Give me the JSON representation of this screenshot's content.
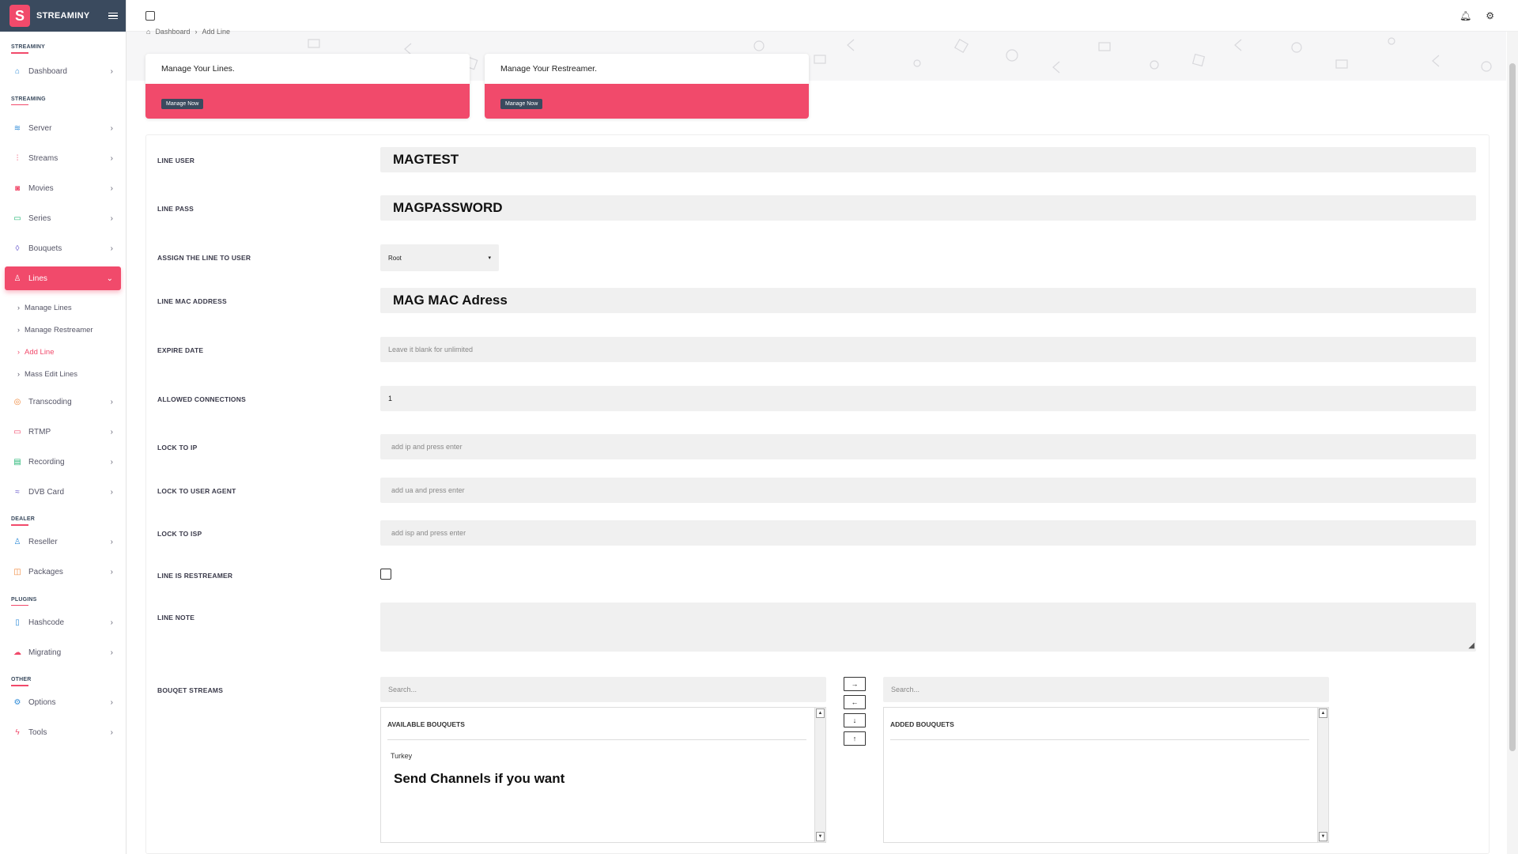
{
  "brand": {
    "name": "STREAMINY",
    "logo_letter": "S"
  },
  "sidebar": {
    "sections": [
      {
        "title": "STREAMINY",
        "items": [
          {
            "label": "Dashboard",
            "icon": "home-icon"
          }
        ]
      },
      {
        "title": "STREAMING",
        "items": [
          {
            "label": "Server",
            "icon": "layers-icon"
          },
          {
            "label": "Streams",
            "icon": "sliders-icon"
          },
          {
            "label": "Movies",
            "icon": "camera-icon"
          },
          {
            "label": "Series",
            "icon": "video-icon"
          },
          {
            "label": "Bouquets",
            "icon": "droplet-icon"
          },
          {
            "label": "Lines",
            "icon": "user-icon"
          }
        ]
      },
      {
        "title": "DEALER",
        "items": [
          {
            "label": "Reseller",
            "icon": "user-plus-icon"
          },
          {
            "label": "Packages",
            "icon": "package-icon"
          }
        ]
      },
      {
        "title": "PLUGINS",
        "items": [
          {
            "label": "Hashcode",
            "icon": "clipboard-icon"
          },
          {
            "label": "Migrating",
            "icon": "cloud-icon"
          }
        ]
      },
      {
        "title": "OTHER",
        "items": [
          {
            "label": "Options",
            "icon": "settings-icon"
          },
          {
            "label": "Tools",
            "icon": "zap-icon"
          }
        ]
      }
    ],
    "lines_sub": [
      "Manage Lines",
      "Manage Restreamer",
      "Add Line",
      "Mass Edit Lines"
    ],
    "after_lines": [
      {
        "label": "Transcoding",
        "icon": "aperture-icon"
      },
      {
        "label": "RTMP",
        "icon": "cast-icon"
      },
      {
        "label": "Recording",
        "icon": "hard-drive-icon"
      },
      {
        "label": "DVB Card",
        "icon": "wifi-icon"
      }
    ]
  },
  "breadcrumb": {
    "home": "⌂",
    "items": [
      "Dashboard",
      "Add Line"
    ]
  },
  "cards": [
    {
      "title": "Manage Your Lines.",
      "button": "Manage Now"
    },
    {
      "title": "Manage Your Restreamer.",
      "button": "Manage Now"
    }
  ],
  "form": {
    "line_user": {
      "label": "LINE USER",
      "value": "MAGTEST"
    },
    "line_pass": {
      "label": "LINE PASS",
      "value": "MAGPASSWORD"
    },
    "assign_user": {
      "label": "ASSIGN THE LINE TO USER",
      "value": "Root"
    },
    "mac": {
      "label": "LINE MAC ADDRESS",
      "value": "MAG MAC Adress"
    },
    "expire": {
      "label": "EXPIRE DATE",
      "placeholder": "Leave it blank for unlimited"
    },
    "connections": {
      "label": "ALLOWED CONNECTIONS",
      "value": "1"
    },
    "lock_ip": {
      "label": "LOCK TO IP",
      "placeholder": "add ip and press enter"
    },
    "lock_ua": {
      "label": "LOCK TO USER AGENT",
      "placeholder": "add ua and press enter"
    },
    "lock_isp": {
      "label": "LOCK TO ISP",
      "placeholder": "add isp and press enter"
    },
    "restreamer": {
      "label": "LINE IS RESTREAMER"
    },
    "note": {
      "label": "LINE NOTE"
    },
    "bouquets": {
      "label": "BOUQET STREAMS",
      "search_left": "Search...",
      "search_right": "Search...",
      "available_title": "AVAILABLE BOUQUETS",
      "added_title": "ADDED BOUQUETS",
      "available_items": [
        "Turkey"
      ],
      "annotation": "Send Channels if you want",
      "move_buttons": [
        "→",
        "←",
        "↓",
        "↑"
      ]
    }
  },
  "colors": {
    "accent": "#f14a6b",
    "brand_bg": "#3a4a5e"
  }
}
